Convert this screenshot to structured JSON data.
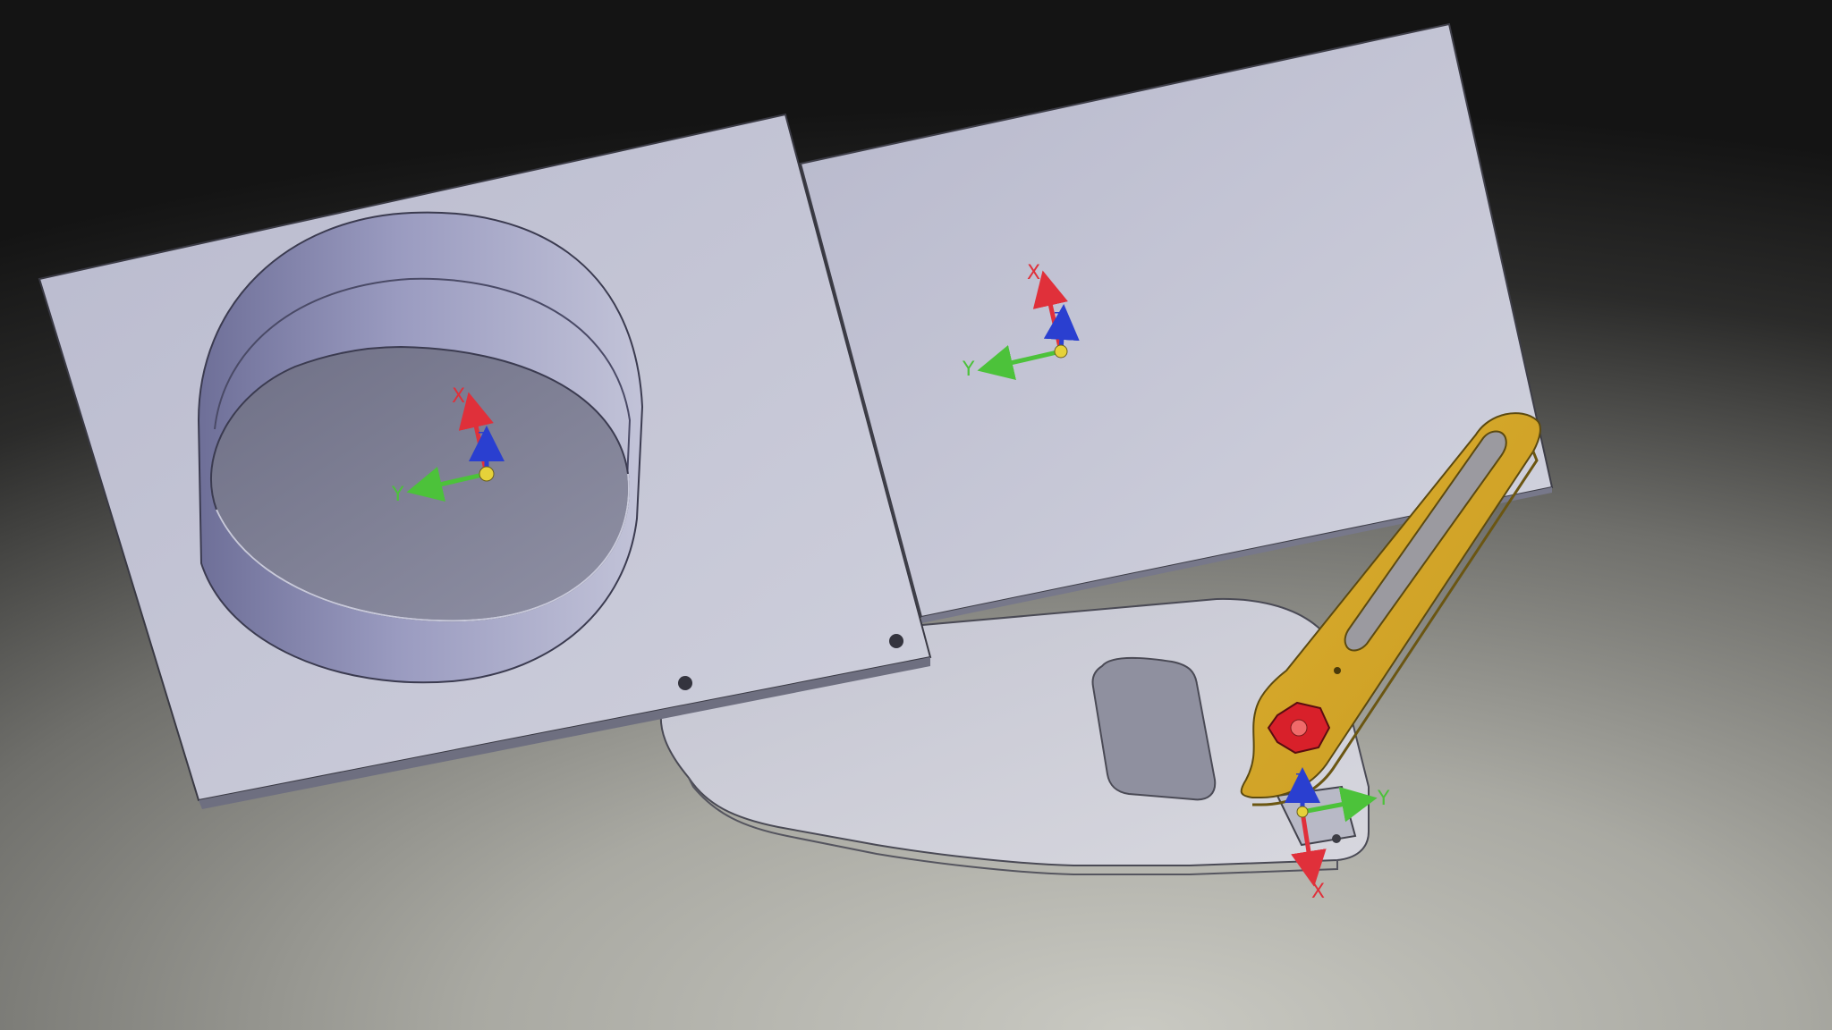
{
  "colors": {
    "background": "#1b1b1b",
    "plate": "#c6c7d6",
    "plate_edge": "#4a4a55",
    "cylinder_wall": "#8e8fb4",
    "cylinder_floor": "#7d7e92",
    "arm": "#d3a52a",
    "arm_edge": "#5c4a10",
    "pivot": "#d8202a",
    "axis_x": "#e0303a",
    "axis_y": "#4cc23a",
    "axis_z": "#2a3fd0",
    "origin": "#e6d23a"
  },
  "scene": {
    "objects": [
      {
        "name": "left-plate-with-cylindrical-recess"
      },
      {
        "name": "right-plate"
      },
      {
        "name": "base-bracket-plate"
      },
      {
        "name": "slotted-arm"
      }
    ]
  },
  "triads": [
    {
      "name": "triad-left-plate",
      "x_label": "X",
      "y_label": "Y",
      "z_label": "Z"
    },
    {
      "name": "triad-right-plate",
      "x_label": "X",
      "y_label": "Y",
      "z_label": "Z"
    },
    {
      "name": "triad-bracket",
      "x_label": "X",
      "y_label": "Y",
      "z_label": "Z"
    }
  ]
}
